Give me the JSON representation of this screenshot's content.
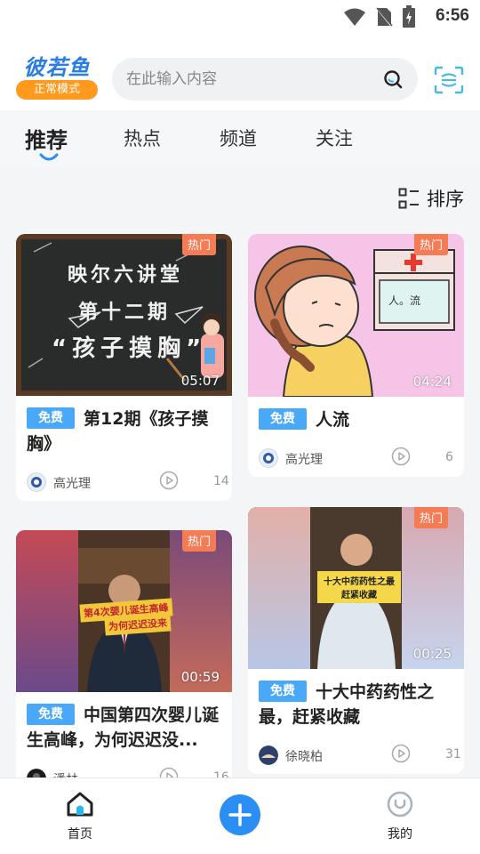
{
  "status_bar": {
    "time": "6:56"
  },
  "header": {
    "logo_text": "彼若鱼",
    "mode_badge": "正常模式",
    "search_placeholder": "在此输入内容"
  },
  "tabs": [
    {
      "label": "推荐",
      "active": true
    },
    {
      "label": "热点",
      "active": false
    },
    {
      "label": "频道",
      "active": false
    },
    {
      "label": "关注",
      "active": false
    }
  ],
  "sort": {
    "label": "排序"
  },
  "cards": [
    {
      "hot_tag": "热门",
      "duration": "05:07",
      "free_badge": "免费",
      "title": "第12期《孩子摸胸》",
      "author": "高光理",
      "plays": "14",
      "thumb_text": [
        "映尔六讲堂",
        "第十二期",
        "“孩子摸胸”"
      ]
    },
    {
      "hot_tag": "热门",
      "duration": "04:24",
      "free_badge": "免费",
      "title": "人流",
      "author": "高光理",
      "plays": "6",
      "thumb_text": [
        "人。流"
      ]
    },
    {
      "hot_tag": "热门",
      "duration": "00:59",
      "free_badge": "免费",
      "title": "中国第四次婴儿诞生高峰，为何迟迟没...",
      "author": "潘林",
      "plays": "16",
      "thumb_text": [
        "第4次婴儿诞生高峰",
        "为何迟迟没来"
      ]
    },
    {
      "hot_tag": "热门",
      "duration": "00:25",
      "free_badge": "免费",
      "title": "十大中药药性之最，赶紧收藏",
      "author": "徐晓柏",
      "plays": "31",
      "thumb_text": [
        "十大中药药性之最",
        "赶紧收藏"
      ]
    }
  ],
  "bottom_nav": {
    "home_label": "首页",
    "mine_label": "我的"
  },
  "colors": {
    "accent": "#2b8ef2",
    "hot": "#f47b54",
    "free": "#4aa8f8",
    "mode": "#ff9a1f"
  }
}
